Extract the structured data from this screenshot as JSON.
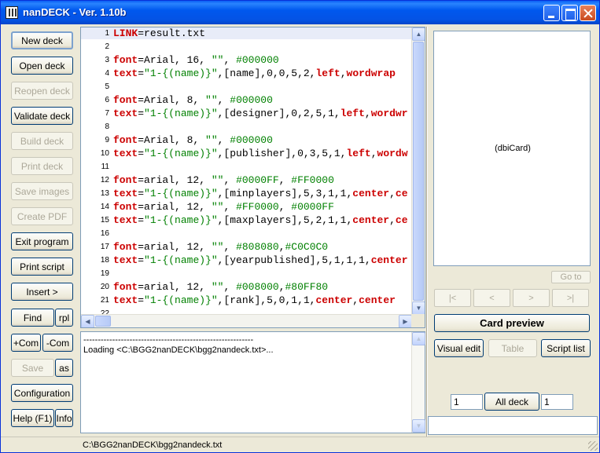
{
  "window": {
    "title": "nanDECK - Ver. 1.10b"
  },
  "left_buttons": [
    {
      "label": "New deck",
      "enabled": true
    },
    {
      "label": "Open deck",
      "enabled": true
    },
    {
      "label": "Reopen deck",
      "enabled": false
    },
    {
      "label": "Validate deck",
      "enabled": true
    },
    {
      "label": "Build deck",
      "enabled": false
    },
    {
      "label": "Print deck",
      "enabled": false
    },
    {
      "label": "Save images",
      "enabled": false
    },
    {
      "label": "Create PDF",
      "enabled": false
    },
    {
      "label": "Exit program",
      "enabled": true
    },
    {
      "label": "Print script",
      "enabled": true
    },
    {
      "label": "Insert >",
      "enabled": true
    }
  ],
  "find": {
    "label": "Find",
    "rpl_label": "rpl"
  },
  "comment": {
    "add_label": "+Com",
    "remove_label": "-Com"
  },
  "save": {
    "label": "Save",
    "as_label": "as"
  },
  "config": {
    "label": "Configuration"
  },
  "help": {
    "label": "Help (F1)",
    "info_label": "Info"
  },
  "code_lines": [
    {
      "n": "1",
      "parts": [
        [
          "k",
          "LINK"
        ],
        [
          "eq",
          "=result.txt"
        ]
      ]
    },
    {
      "n": "2",
      "parts": []
    },
    {
      "n": "3",
      "parts": [
        [
          "k",
          "font"
        ],
        [
          "eq",
          "=Arial, 16, "
        ],
        [
          "s",
          "\"\""
        ],
        [
          "eq",
          ", "
        ],
        [
          "s",
          "#000000"
        ]
      ]
    },
    {
      "n": "4",
      "parts": [
        [
          "k",
          "text"
        ],
        [
          "eq",
          "="
        ],
        [
          "s",
          "\"1-{(name)}\""
        ],
        [
          "eq",
          ",[name],0,0,5,2,"
        ],
        [
          "k",
          "left"
        ],
        [
          "eq",
          ","
        ],
        [
          "k",
          "wordwrap"
        ]
      ]
    },
    {
      "n": "5",
      "parts": []
    },
    {
      "n": "6",
      "parts": [
        [
          "k",
          "font"
        ],
        [
          "eq",
          "=Arial, 8, "
        ],
        [
          "s",
          "\"\""
        ],
        [
          "eq",
          ", "
        ],
        [
          "s",
          "#000000"
        ]
      ]
    },
    {
      "n": "7",
      "parts": [
        [
          "k",
          "text"
        ],
        [
          "eq",
          "="
        ],
        [
          "s",
          "\"1-{(name)}\""
        ],
        [
          "eq",
          ",[designer],0,2,5,1,"
        ],
        [
          "k",
          "left"
        ],
        [
          "eq",
          ","
        ],
        [
          "k",
          "wordwr"
        ]
      ]
    },
    {
      "n": "8",
      "parts": []
    },
    {
      "n": "9",
      "parts": [
        [
          "k",
          "font"
        ],
        [
          "eq",
          "=Arial, 8, "
        ],
        [
          "s",
          "\"\""
        ],
        [
          "eq",
          ", "
        ],
        [
          "s",
          "#000000"
        ]
      ]
    },
    {
      "n": "10",
      "parts": [
        [
          "k",
          "text"
        ],
        [
          "eq",
          "="
        ],
        [
          "s",
          "\"1-{(name)}\""
        ],
        [
          "eq",
          ",[publisher],0,3,5,1,"
        ],
        [
          "k",
          "left"
        ],
        [
          "eq",
          ","
        ],
        [
          "k",
          "wordw"
        ]
      ]
    },
    {
      "n": "11",
      "parts": []
    },
    {
      "n": "12",
      "parts": [
        [
          "k",
          "font"
        ],
        [
          "eq",
          "=arial, 12, "
        ],
        [
          "s",
          "\"\""
        ],
        [
          "eq",
          ", "
        ],
        [
          "s",
          "#0000FF"
        ],
        [
          "eq",
          ", "
        ],
        [
          "s",
          "#FF0000"
        ]
      ]
    },
    {
      "n": "13",
      "parts": [
        [
          "k",
          "text"
        ],
        [
          "eq",
          "="
        ],
        [
          "s",
          "\"1-{(name)}\""
        ],
        [
          "eq",
          ",[minplayers],5,3,1,1,"
        ],
        [
          "k",
          "center"
        ],
        [
          "eq",
          ","
        ],
        [
          "k",
          "ce"
        ]
      ]
    },
    {
      "n": "14",
      "parts": [
        [
          "k",
          "font"
        ],
        [
          "eq",
          "=arial, 12, "
        ],
        [
          "s",
          "\"\""
        ],
        [
          "eq",
          ", "
        ],
        [
          "s",
          "#FF0000"
        ],
        [
          "eq",
          ", "
        ],
        [
          "s",
          "#0000FF"
        ]
      ]
    },
    {
      "n": "15",
      "parts": [
        [
          "k",
          "text"
        ],
        [
          "eq",
          "="
        ],
        [
          "s",
          "\"1-{(name)}\""
        ],
        [
          "eq",
          ",[maxplayers],5,2,1,1,"
        ],
        [
          "k",
          "center"
        ],
        [
          "eq",
          ","
        ],
        [
          "k",
          "ce"
        ]
      ]
    },
    {
      "n": "16",
      "parts": []
    },
    {
      "n": "17",
      "parts": [
        [
          "k",
          "font"
        ],
        [
          "eq",
          "=arial, 12, "
        ],
        [
          "s",
          "\"\""
        ],
        [
          "eq",
          ", "
        ],
        [
          "s",
          "#808080"
        ],
        [
          "eq",
          ","
        ],
        [
          "s",
          "#C0C0C0"
        ]
      ]
    },
    {
      "n": "18",
      "parts": [
        [
          "k",
          "text"
        ],
        [
          "eq",
          "="
        ],
        [
          "s",
          "\"1-{(name)}\""
        ],
        [
          "eq",
          ",[yearpublished],5,1,1,1,"
        ],
        [
          "k",
          "center"
        ]
      ]
    },
    {
      "n": "19",
      "parts": []
    },
    {
      "n": "20",
      "parts": [
        [
          "k",
          "font"
        ],
        [
          "eq",
          "=arial, 12, "
        ],
        [
          "s",
          "\"\""
        ],
        [
          "eq",
          ", "
        ],
        [
          "s",
          "#008000"
        ],
        [
          "eq",
          ","
        ],
        [
          "s",
          "#80FF80"
        ]
      ]
    },
    {
      "n": "21",
      "parts": [
        [
          "k",
          "text"
        ],
        [
          "eq",
          "="
        ],
        [
          "s",
          "\"1-{(name)}\""
        ],
        [
          "eq",
          ",[rank],5,0,1,1,"
        ],
        [
          "k",
          "center"
        ],
        [
          "eq",
          ","
        ],
        [
          "k",
          "center"
        ]
      ]
    },
    {
      "n": "22",
      "parts": []
    }
  ],
  "log": {
    "separator": "-----------------------------------------------------------",
    "message": "Loading <C:\\BGG2nanDECK\\bgg2nandeck.txt>..."
  },
  "status": {
    "path": "C:\\BGG2nanDECK\\bgg2nandeck.txt"
  },
  "preview": {
    "label": "(dbiCard)"
  },
  "goto": {
    "label": "Go to"
  },
  "nav": {
    "first": "|<",
    "prev": "<",
    "next": ">",
    "last": ">|"
  },
  "card_preview": {
    "label": "Card preview"
  },
  "right_buttons": {
    "visual_edit": "Visual edit",
    "table": "Table",
    "script_list": "Script list"
  },
  "range": {
    "from": "1",
    "to": "1",
    "all_label": "All deck"
  },
  "colors": {
    "title_bar": "#0058ee",
    "keyword": "#cc0000",
    "string": "#008000"
  }
}
